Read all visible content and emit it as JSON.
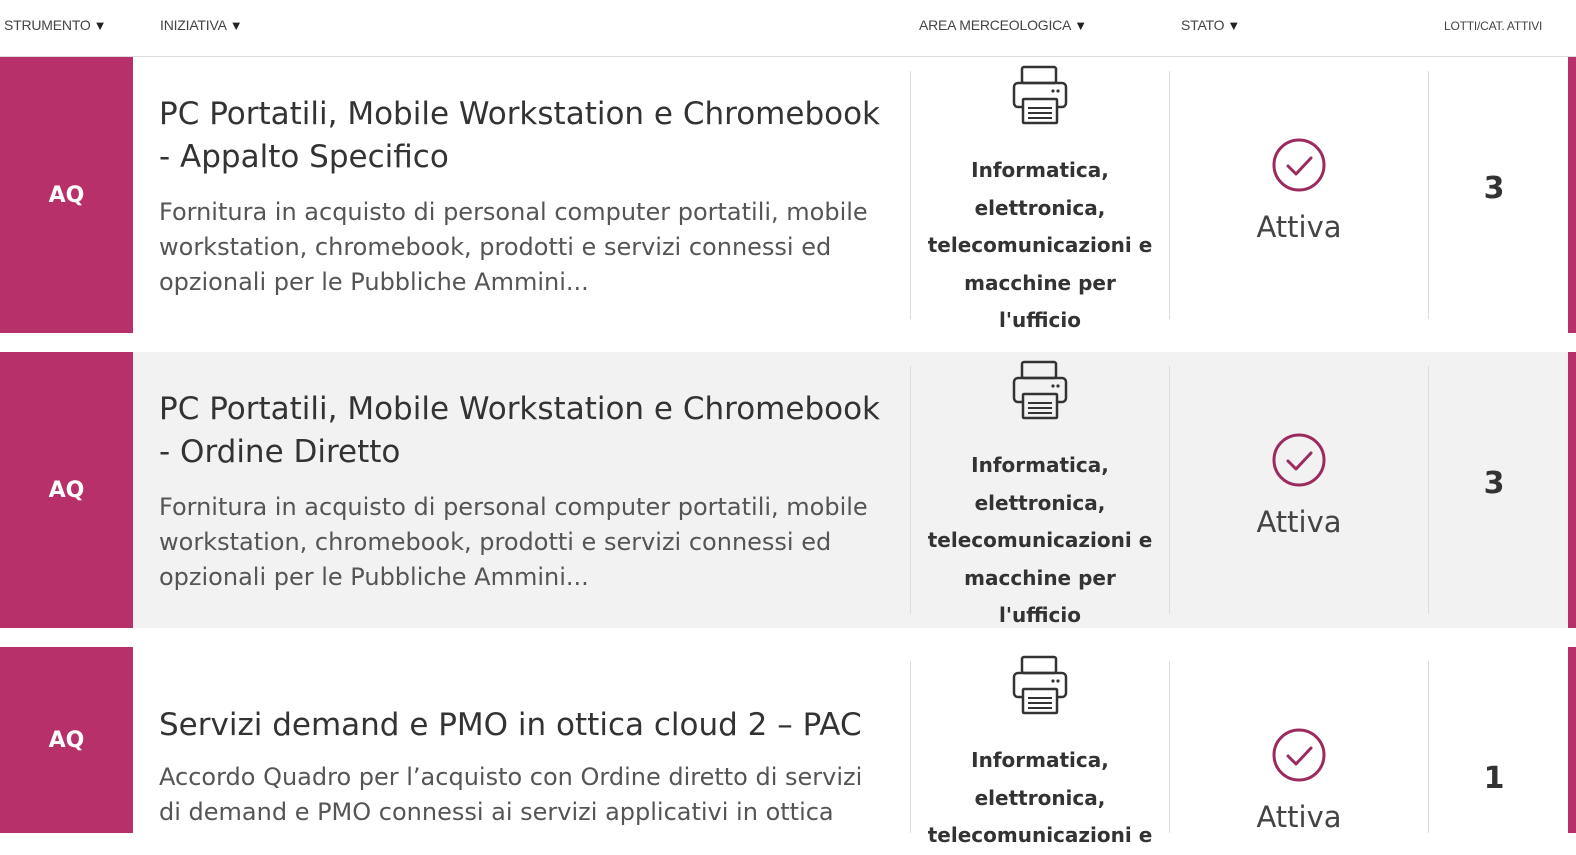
{
  "header": {
    "strumento": "STRUMENTO",
    "iniziativa": "INIZIATIVA",
    "area": "AREA MERCEOLOGICA",
    "stato": "STATO",
    "lotti": "LOTTI/CAT. ATTIVI",
    "sort_arrow": "▼"
  },
  "rows": [
    {
      "strumento": "AQ",
      "title_line1": "PC Portatili, Mobile Workstation e Chromebook",
      "title_line2": "- Appalto Specifico",
      "desc_lines": [
        "Fornitura in acquisto di personal computer portatili, mobile",
        "workstation, chromebook, prodotti e servizi connessi ed",
        "opzionali per le Pubbliche Ammini..."
      ],
      "area_icon": "printer-icon",
      "area_lines": [
        "Informatica,",
        "elettronica,",
        "telecomunicazioni e",
        "macchine per",
        "l'ufficio"
      ],
      "stato_icon": "check-circle-icon",
      "stato": "Attiva",
      "lotti": "3"
    },
    {
      "strumento": "AQ",
      "title_line1": "PC Portatili, Mobile Workstation e Chromebook",
      "title_line2": "- Ordine Diretto",
      "desc_lines": [
        "Fornitura in acquisto di personal computer portatili, mobile",
        "workstation, chromebook, prodotti e servizi connessi ed",
        "opzionali per le Pubbliche Ammini..."
      ],
      "area_icon": "printer-icon",
      "area_lines": [
        "Informatica,",
        "elettronica,",
        "telecomunicazioni e",
        "macchine per",
        "l'ufficio"
      ],
      "stato_icon": "check-circle-icon",
      "stato": "Attiva",
      "lotti": "3"
    },
    {
      "strumento": "AQ",
      "title_line1": "Servizi demand e PMO in ottica cloud 2 – PAC",
      "desc_lines": [
        "Accordo Quadro per l’acquisto con Ordine diretto di servizi",
        "di demand e PMO connessi ai servizi applicativi in ottica"
      ],
      "area_icon": "printer-icon",
      "area_lines": [
        "Informatica,",
        "elettronica,",
        "telecomunicazioni e"
      ],
      "stato_icon": "check-circle-icon",
      "stato": "Attiva",
      "lotti": "1"
    }
  ],
  "colors": {
    "accent": "#b8306a",
    "row_alt": "#f2f2f2"
  }
}
